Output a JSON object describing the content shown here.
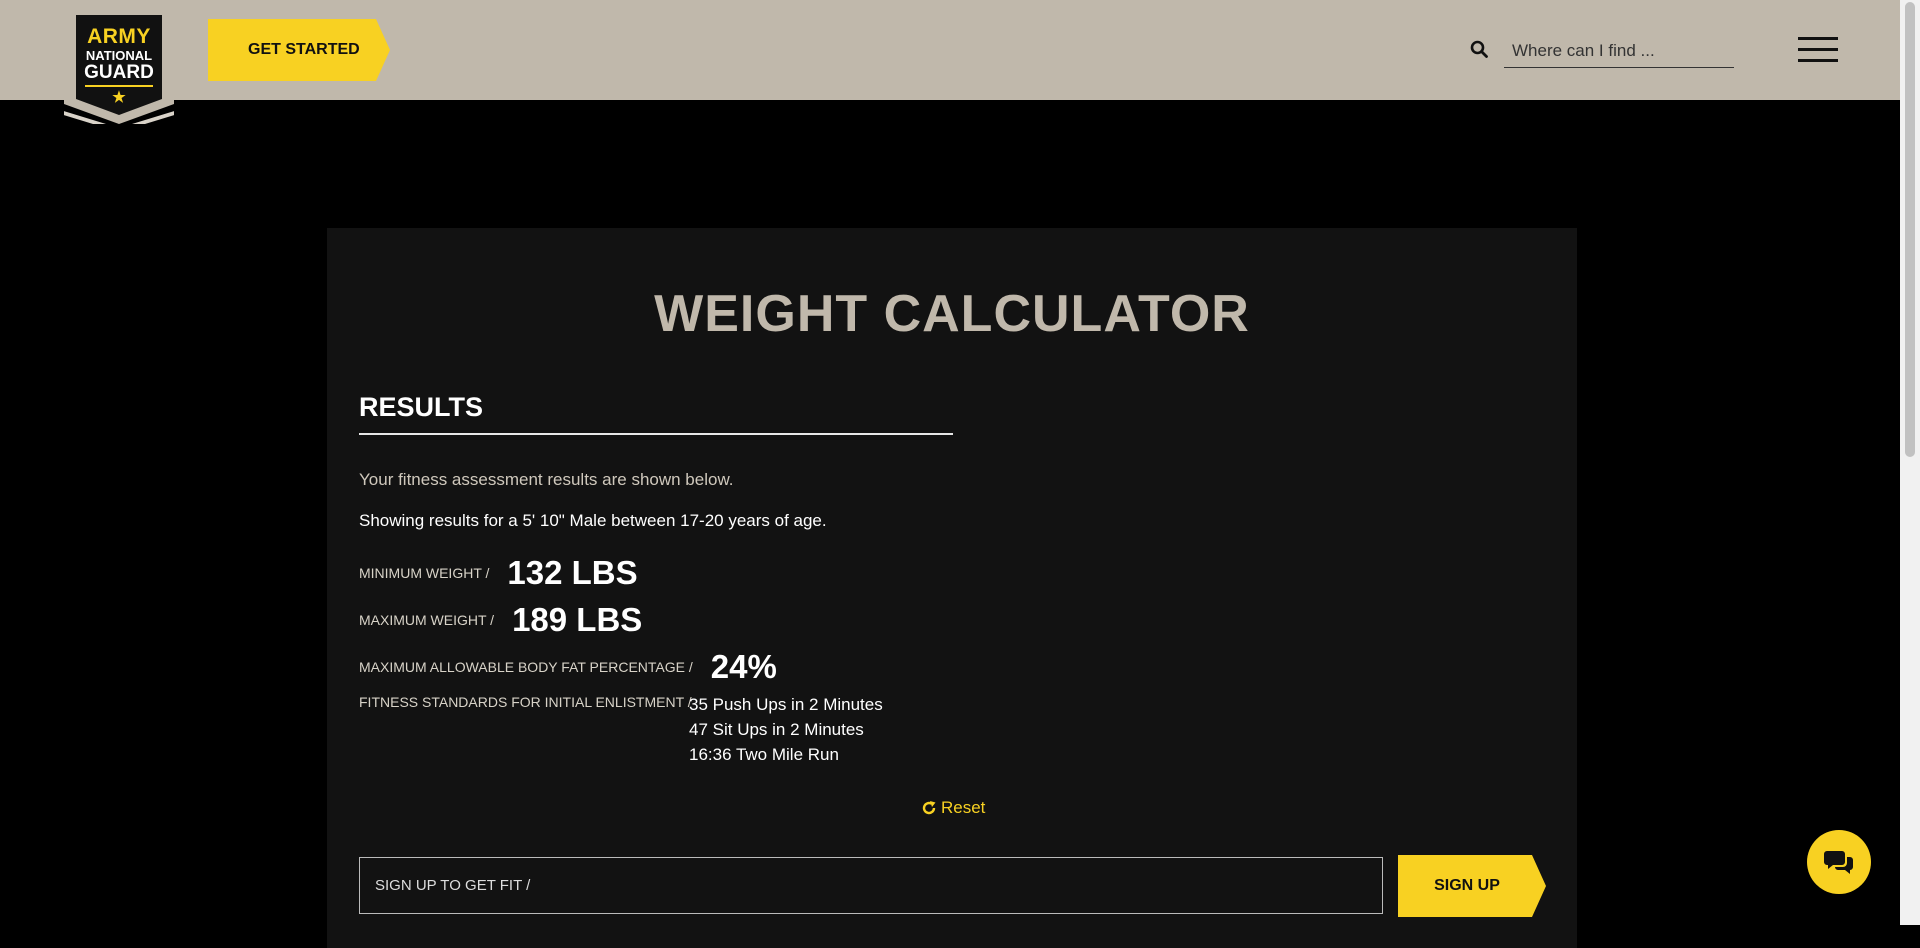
{
  "header": {
    "logo": {
      "line1": "ARMY",
      "line2": "NATIONAL",
      "line3": "GUARD",
      "star": "★"
    },
    "get_started_label": "GET STARTED",
    "search": {
      "placeholder": "Where can I find ...",
      "icon": "search-icon"
    },
    "menu_icon": "hamburger-menu-icon"
  },
  "calculator": {
    "title": "WEIGHT CALCULATOR",
    "results_heading": "RESULTS",
    "intro": "Your fitness assessment results are shown below.",
    "showing": "Showing results for a 5' 10\" Male between 17-20 years of age.",
    "min_weight": {
      "label": "MINIMUM WEIGHT /",
      "value": "132 LBS"
    },
    "max_weight": {
      "label": "MAXIMUM WEIGHT /",
      "value": "189 LBS"
    },
    "body_fat": {
      "label": "MAXIMUM ALLOWABLE BODY FAT PERCENTAGE /",
      "value": "24%"
    },
    "fitness": {
      "label": "FITNESS STANDARDS FOR INITIAL ENLISTMENT /",
      "items": [
        "35 Push Ups in 2 Minutes",
        "47 Sit Ups in 2 Minutes",
        "16:36 Two Mile Run"
      ]
    },
    "reset_label": "Reset",
    "signup": {
      "placeholder": "SIGN UP TO GET FIT /",
      "button_label": "SIGN UP"
    }
  },
  "chat_icon": "chat-bubbles-icon",
  "colors": {
    "accent": "#f8d122",
    "header_bg": "#c0b8ab",
    "card_bg": "#121212",
    "title": "#c0b8ab"
  }
}
